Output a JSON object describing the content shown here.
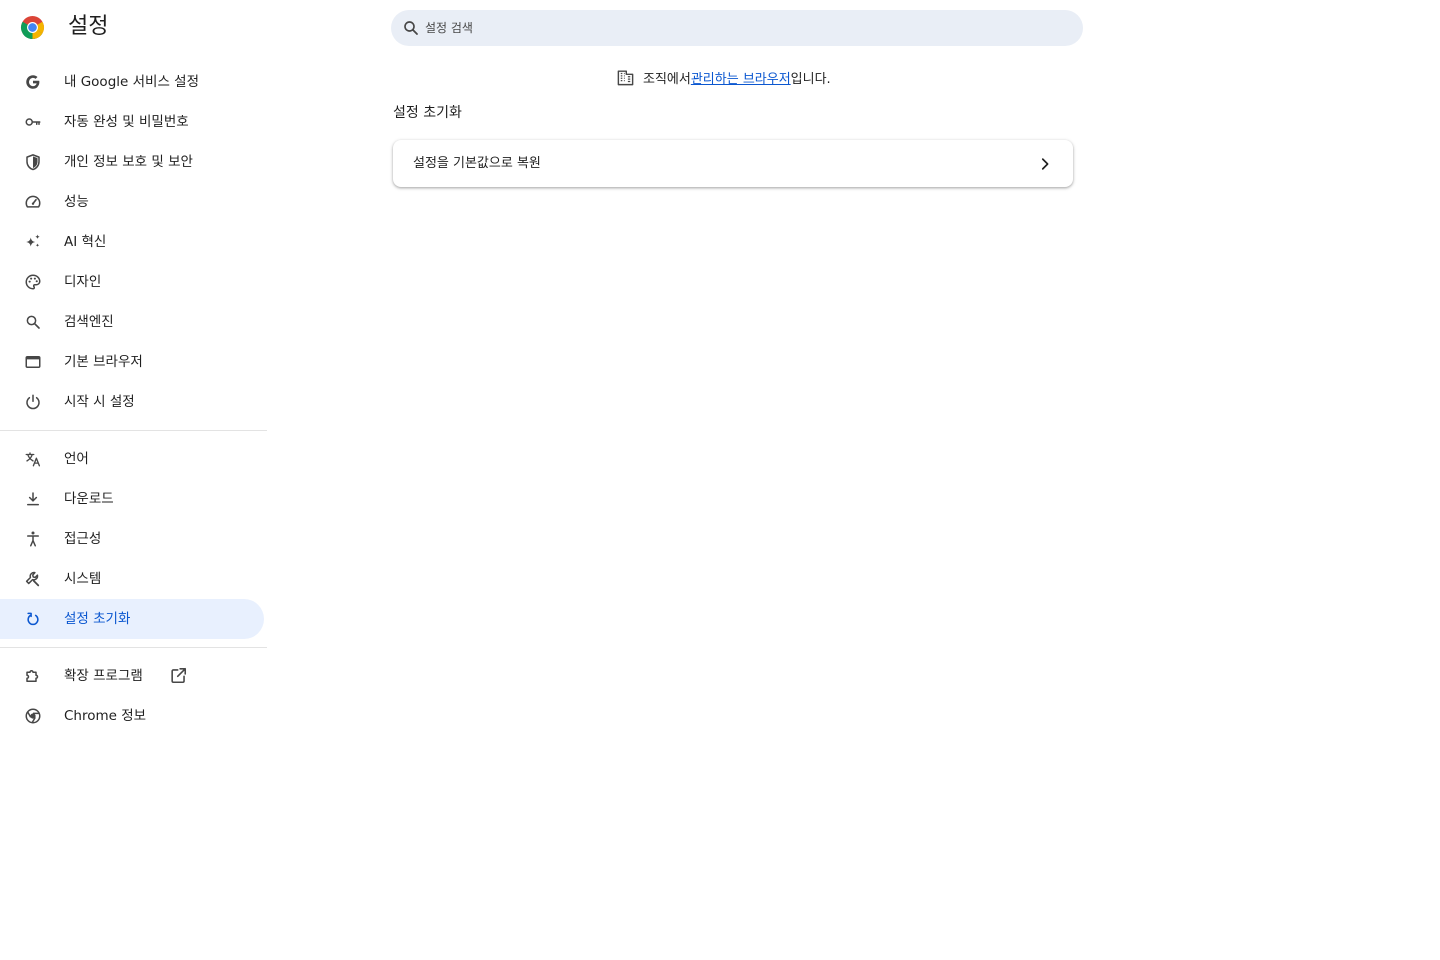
{
  "header": {
    "title": "설정",
    "logo_icon": "chrome-logo-icon",
    "search": {
      "placeholder": "설정 검색",
      "value": "",
      "icon": "search-icon"
    }
  },
  "sidebar": {
    "groups": [
      {
        "items": [
          {
            "label": "내 Google 서비스 설정",
            "icon": "google-g-icon"
          },
          {
            "label": "자동 완성 및 비밀번호",
            "icon": "key-icon"
          },
          {
            "label": "개인 정보 보호 및 보안",
            "icon": "shield-icon"
          },
          {
            "label": "성능",
            "icon": "speedometer-icon"
          },
          {
            "label": "AI 혁신",
            "icon": "sparkle-icon"
          },
          {
            "label": "디자인",
            "icon": "palette-icon"
          },
          {
            "label": "검색엔진",
            "icon": "search-icon"
          },
          {
            "label": "기본 브라우저",
            "icon": "browser-window-icon"
          },
          {
            "label": "시작 시 설정",
            "icon": "power-icon"
          }
        ]
      },
      {
        "items": [
          {
            "label": "언어",
            "icon": "translate-icon"
          },
          {
            "label": "다운로드",
            "icon": "download-icon"
          },
          {
            "label": "접근성",
            "icon": "accessibility-icon"
          },
          {
            "label": "시스템",
            "icon": "wrench-icon"
          },
          {
            "label": "설정 초기화",
            "icon": "reset-icon",
            "active": true
          }
        ]
      },
      {
        "items": [
          {
            "label": "확장 프로그램",
            "icon": "puzzle-icon",
            "external_icon": "open-in-new-icon"
          },
          {
            "label": "Chrome 정보",
            "icon": "chrome-outline-icon"
          }
        ]
      }
    ]
  },
  "main": {
    "managed_notice": {
      "icon": "building-icon",
      "prefix": "조직에서 ",
      "link": "관리하는 브라우저",
      "suffix": "입니다."
    },
    "section_title": "설정 초기화",
    "card": {
      "row_label": "설정을 기본값으로 복원",
      "row_icon": "chevron-right-icon"
    }
  },
  "colors": {
    "accent": "#0b57d0",
    "active_bg": "#e8f0fe",
    "search_bg": "#e9eef6",
    "icon": "#474747",
    "text": "#1f1f1f"
  }
}
